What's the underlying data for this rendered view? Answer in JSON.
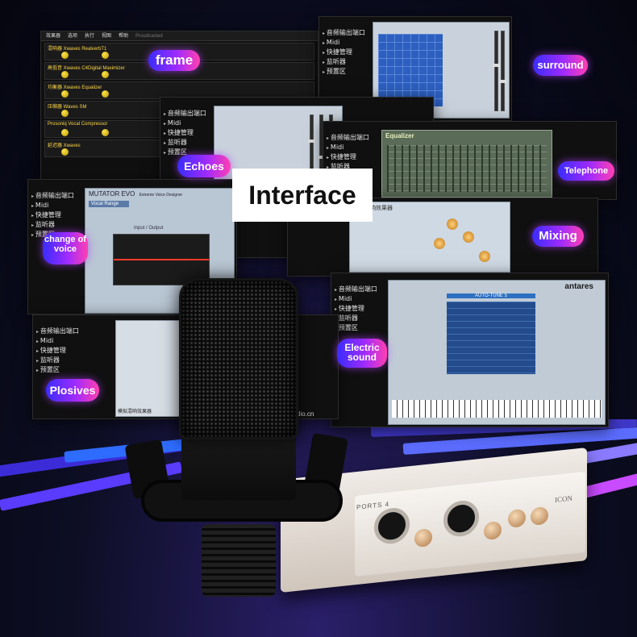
{
  "labels": {
    "interface": "Interface",
    "frame": "frame",
    "surround": "surround",
    "echoes": "Echoes",
    "telephone": "Telephone",
    "change_of_voice": "change of voice",
    "mixing": "Mixing",
    "electric_sound": "Electric sound",
    "plosives": "Plosives"
  },
  "windows": {
    "main_menu": {
      "items": [
        "音频输出端口",
        "Midi",
        "快捷管理",
        "监听器",
        "预置区"
      ]
    },
    "plugin_host": {
      "menu": [
        "效果器",
        "选项",
        "执行",
        "视图",
        "帮助",
        "Proudcasted"
      ],
      "rows": [
        "混响器 Xwaves RealverbT1",
        "高低音 Xwaves C4Digital Maximizer",
        "均衡器 Xwaves Equalizer",
        "压缩器 Waves SM",
        "Prosoniq Vocal Compressor",
        "延迟器 Xwaves"
      ]
    },
    "mutator": {
      "title": "MUTATOR EVO",
      "subtitle": "Extreme Voice Designer",
      "section": "Vocal Range",
      "io": "Input / Output"
    },
    "equalizer": {
      "title": "Equalizer"
    },
    "autotune": {
      "brand": "antares",
      "title": "AUTO-TUNE 5"
    },
    "mixer": {
      "title": "模拟混响效果器",
      "url": "dio.cn"
    }
  },
  "device": {
    "brand": "ICON",
    "model": "ports 4"
  }
}
